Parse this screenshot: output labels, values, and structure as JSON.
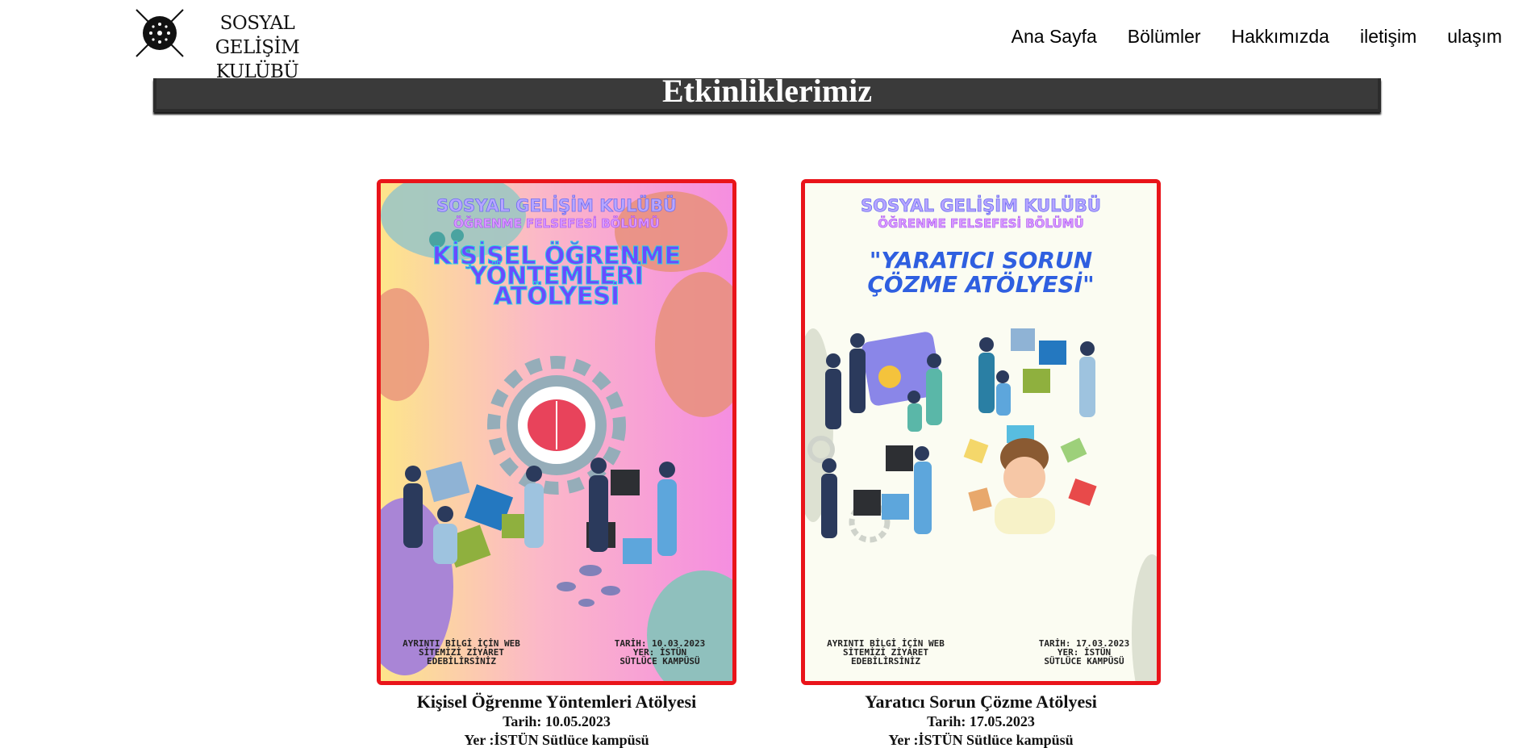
{
  "header": {
    "logo_line1": "SOSYAL GELİŞİM",
    "logo_line2": "KULÜBÜ",
    "nav": [
      "Ana Sayfa",
      "Bölümler",
      "Hakkımızda",
      "iletişim",
      "ulaşım"
    ]
  },
  "banner": {
    "title": "Etkinliklerimiz"
  },
  "events": [
    {
      "poster": {
        "club": "SOSYAL GELİŞİM KULÜBÜ",
        "dept": "ÖĞRENME FELSEFESİ BÖLÜMÜ",
        "headline1": "KİŞİSEL ÖĞRENME",
        "headline2": "YÖNTEMLERİ",
        "headline3": "ATÖLYESİ",
        "footer_left1": "AYRINTI BİLGİ İÇİN WEB",
        "footer_left2": "SİTEMİZİ ZİYARET",
        "footer_left3": "EDEBİLİRSİNİZ",
        "footer_right1": "TARİH: 10.03.2023",
        "footer_right2": "YER: İSTÜN",
        "footer_right3": "SÜTLÜCE KAMPÜSÜ"
      },
      "title": "Kişisel Öğrenme Yöntemleri Atölyesi",
      "date": "Tarih: 10.05.2023",
      "place": "Yer :İSTÜN Sütlüce kampüsü"
    },
    {
      "poster": {
        "club": "SOSYAL GELİŞİM KULÜBÜ",
        "dept": "ÖĞRENME FELSEFESİ BÖLÜMÜ",
        "headline1": "\"YARATICI SORUN",
        "headline2": "ÇÖZME ATÖLYESİ\"",
        "footer_left1": "AYRINTI BİLGİ İÇİN WEB",
        "footer_left2": "SİTEMİZİ ZİYARET",
        "footer_left3": "EDEBİLİRSİNİZ",
        "footer_right1": "TARİH: 17.03.2023",
        "footer_right2": "YER: İSTÜN",
        "footer_right3": "SÜTLÜCE KAMPÜSÜ"
      },
      "title": "Yaratıcı Sorun Çözme Atölyesi",
      "date": "Tarih: 17.05.2023",
      "place": "Yer :İSTÜN Sütlüce kampüsü"
    }
  ]
}
